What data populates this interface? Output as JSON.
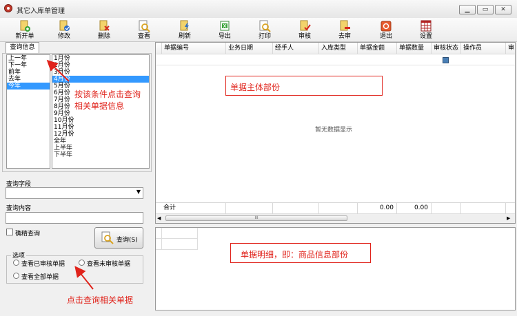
{
  "window": {
    "title": "其它入库单管理"
  },
  "toolbar": {
    "items": [
      {
        "label": "新开单",
        "icon": "new-doc-icon"
      },
      {
        "label": "修改",
        "icon": "edit-icon"
      },
      {
        "label": "删除",
        "icon": "delete-icon"
      },
      {
        "label": "查看",
        "icon": "view-icon"
      },
      {
        "label": "刷新",
        "icon": "refresh-icon"
      },
      {
        "label": "导出",
        "icon": "export-icon"
      },
      {
        "label": "打印",
        "icon": "print-icon"
      },
      {
        "label": "审核",
        "icon": "approve-icon"
      },
      {
        "label": "去审",
        "icon": "unapprove-icon"
      },
      {
        "label": "退出",
        "icon": "exit-icon"
      },
      {
        "label": "设置",
        "icon": "settings-icon"
      }
    ]
  },
  "query": {
    "tab_label": "查询信息",
    "years": [
      "上一年",
      "下一年",
      "前年",
      "去年",
      "今年"
    ],
    "selected_year": "今年",
    "months": [
      "1月份",
      "2月份",
      "3月份",
      "4月份",
      "5月份",
      "6月份",
      "7月份",
      "8月份",
      "9月份",
      "10月份",
      "11月份",
      "12月份",
      "全年",
      "上半年",
      "下半年"
    ],
    "selected_month": "4月份",
    "field_label": "查询字段",
    "field_value": "",
    "content_label": "查询内容",
    "content_value": "",
    "exact_label": "确精查询",
    "search_label": "查询(S)",
    "options_label": "选项",
    "options": [
      "查看已审核单据",
      "查看未审核单据",
      "查看全部单据"
    ]
  },
  "grid": {
    "columns": [
      "单据编号",
      "业务日期",
      "经手人",
      "入库类型",
      "单据金额",
      "单据数量",
      "审核状态",
      "操作员",
      "审"
    ],
    "empty_text": "暂无数据显示",
    "footer_label": "合计",
    "total_amount": "0.00",
    "total_qty": "0.00",
    "scroll_grip": "III"
  },
  "annotations": {
    "query_hint_line1": "按该条件点击查询",
    "query_hint_line2": "相关单据信息",
    "main_label": "单据主体部份",
    "detail_label": "单据明细，即：商品信息部份",
    "option_hint": "点击查询相关单据"
  },
  "colors": {
    "annotation": "#e0231b",
    "selection": "#3399ff"
  }
}
